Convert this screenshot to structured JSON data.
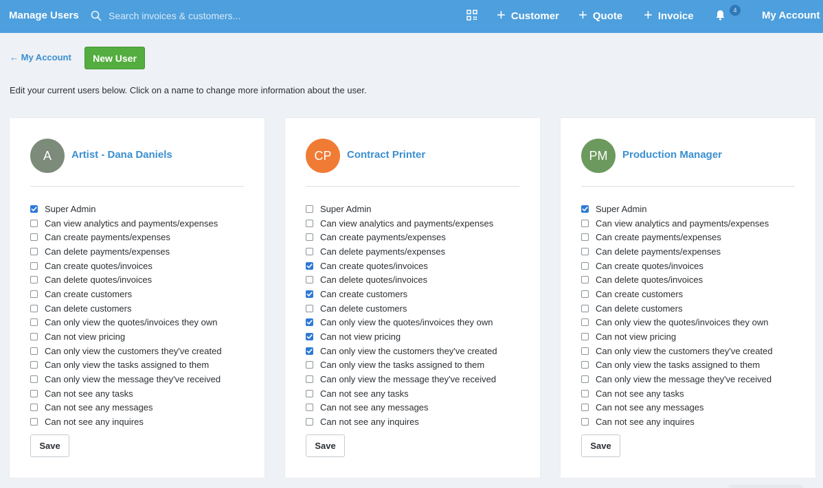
{
  "topbar": {
    "title": "Manage Users",
    "search_placeholder": "Search invoices & customers...",
    "add_customer": "Customer",
    "add_quote": "Quote",
    "add_invoice": "Invoice",
    "notifications_count": "4",
    "account": "My Account",
    "icons": {
      "search": "search-icon",
      "qr": "qr-code-icon",
      "plus": "plus-icon",
      "bell": "bell-icon"
    }
  },
  "subheader": {
    "back_label": "← My Account",
    "new_user_label": "New User",
    "intro": "Edit your current users below. Click on a name to change more information about the user."
  },
  "permission_labels": [
    "Super Admin",
    "Can view analytics and payments/expenses",
    "Can create payments/expenses",
    "Can delete payments/expenses",
    "Can create quotes/invoices",
    "Can delete quotes/invoices",
    "Can create customers",
    "Can delete customers",
    "Can only view the quotes/invoices they own",
    "Can not view pricing",
    "Can only view the customers they've created",
    "Can only view the tasks assigned to them",
    "Can only view the message they've received",
    "Can not see any tasks",
    "Can not see any messages",
    "Can not see any inquires"
  ],
  "users": [
    {
      "initials": "A",
      "name": "Artist - Dana Daniels",
      "avatar_color": "#7d8b7a",
      "checked": [
        0
      ],
      "save_label": "Save"
    },
    {
      "initials": "CP",
      "name": "Contract Printer",
      "avatar_color": "#f07b34",
      "checked": [
        4,
        6,
        8,
        9,
        10
      ],
      "save_label": "Save"
    },
    {
      "initials": "PM",
      "name": "Production Manager",
      "avatar_color": "#6c9a5e",
      "checked": [
        0
      ],
      "save_label": "Save"
    }
  ],
  "colors": {
    "topbar": "#4d9fdd",
    "accent_link": "#3a8fd0",
    "new_user_button": "#54ad3f",
    "checkbox_checked": "#2e7ad6",
    "background": "#eef1f5"
  }
}
